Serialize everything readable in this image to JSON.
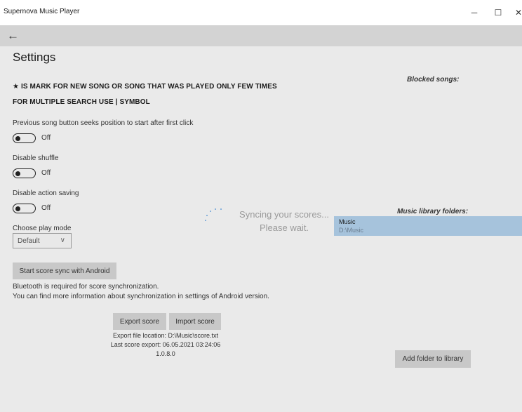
{
  "window": {
    "title": "Supernova Music Player",
    "controls": {
      "minimize": "─",
      "maximize": "☐",
      "close": "✕"
    }
  },
  "nav": {
    "back": "←"
  },
  "page": {
    "title": "Settings",
    "notice1": "★ IS MARK FOR NEW SONG OR SONG THAT WAS PLAYED ONLY FEW TIMES",
    "notice2": "FOR MULTIPLE SEARCH USE | SYMBOL"
  },
  "settings": {
    "prev_seek": {
      "label": "Previous song button seeks position to start after first click",
      "state": "Off",
      "on": false
    },
    "disable_shuffle": {
      "label": "Disable shuffle",
      "state": "Off",
      "on": false
    },
    "disable_action_saving": {
      "label": "Disable action saving",
      "state": "Off",
      "on": false
    },
    "play_mode": {
      "label": "Choose play mode",
      "value": "Default",
      "chevron": "∨"
    }
  },
  "sync": {
    "button": "Start score sync with Android",
    "info1": "Bluetooth is required for score synchronization.",
    "info2": "You can find more information about synchronization in settings of Android version.",
    "overlay_line1": "Syncing your scores...",
    "overlay_line2": "Please wait."
  },
  "score": {
    "export_button": "Export score",
    "import_button": "Import score",
    "export_location": "Export file location: D:\\Music\\score.txt",
    "last_export": "Last score export: 06.05.2021 03:24:06",
    "version": "1.0.8.0"
  },
  "right_panel": {
    "blocked_heading": "Blocked songs:",
    "library_heading": "Music library folders:",
    "folders": [
      {
        "name": "Music",
        "path": "D:\\Music"
      }
    ],
    "add_folder_button": "Add folder to library"
  },
  "colors": {
    "background": "#eaeaea",
    "navbar": "#d3d3d3",
    "selection": "#a6c3dc",
    "button": "#c8c8c8",
    "spinner": "#6aa0d8"
  }
}
